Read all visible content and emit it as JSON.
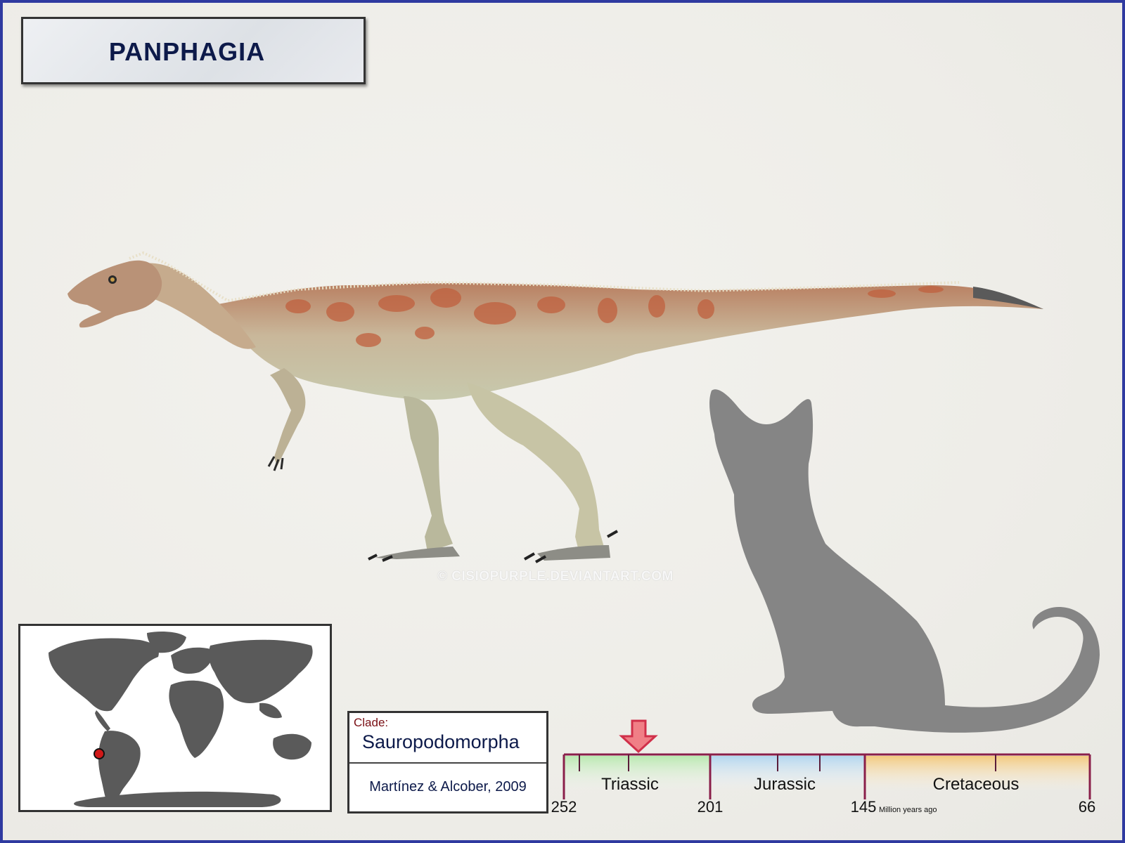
{
  "title": "PANPHAGIA",
  "watermark": "© CISIOPURPLE.DEVIANTART.COM",
  "clade": {
    "label": "Clade:",
    "name": "Sauropodomorpha",
    "author": "Martínez & Alcober, 2009"
  },
  "timeline": {
    "periods": [
      "Triassic",
      "Jurassic",
      "Cretaceous"
    ],
    "ticks": [
      "252",
      "201",
      "145",
      "66"
    ],
    "unit": "Million years ago"
  },
  "colors": {
    "frame": "#2f3aa0",
    "silhouette": "#858585",
    "title_text": "#0d1a4a",
    "clade_label": "#7a0f14",
    "triassic": "#cfeec9",
    "jurassic": "#c8dff0",
    "cretaceous": "#f5d49a",
    "timeline_line": "#8a1f4a",
    "arrow": "#f07f86",
    "map_location": "#d01818"
  },
  "icons": {
    "arrow": "down-arrow-icon",
    "location": "location-dot-icon"
  }
}
